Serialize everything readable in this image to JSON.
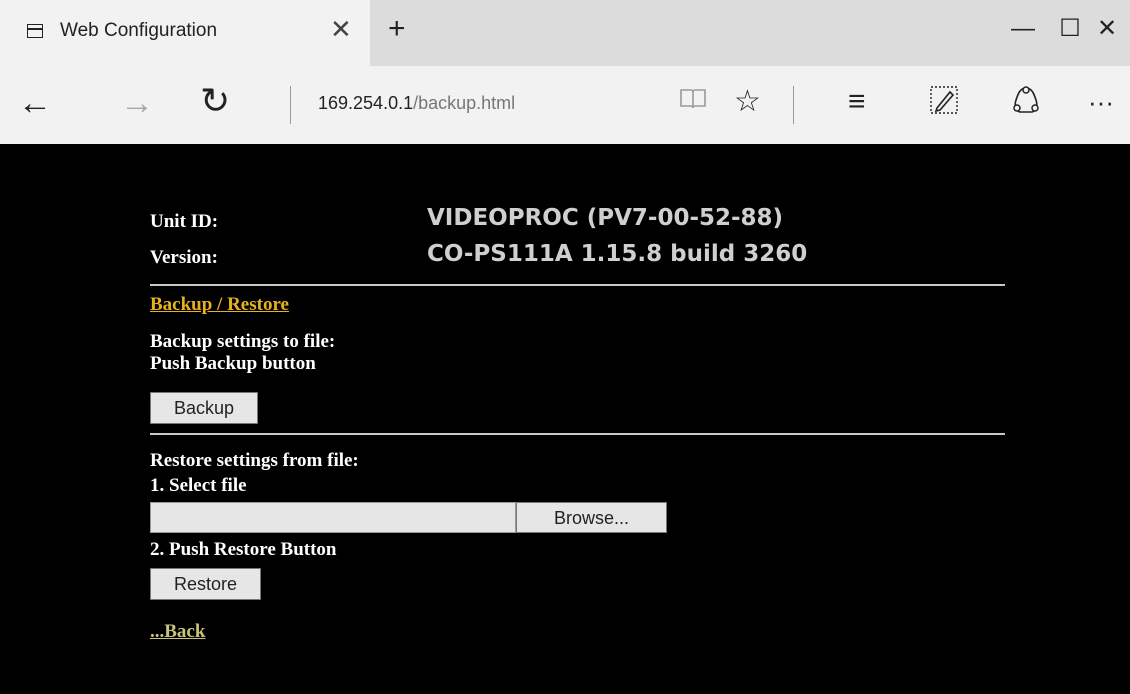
{
  "browser": {
    "tab_title": "Web Configuration",
    "tab_close": "✕",
    "new_tab": "+",
    "window": {
      "minimize": "—",
      "maximize": "☐",
      "close": "✕"
    },
    "nav": {
      "back": "←",
      "forward": "→",
      "refresh": "↻"
    },
    "url_host": "169.254.0.1",
    "url_path": "/backup.html",
    "tools": {
      "reading_view": "📖",
      "favorite": "☆",
      "hub": "≡",
      "web_note": "✎",
      "share": "⌂",
      "more": "···"
    }
  },
  "info": {
    "unit_id_label": "Unit ID:",
    "unit_id_value": "VIDEOPROC (PV7-00-52-88)",
    "version_label": "Version:",
    "version_value": "CO-PS111A 1.15.8 build 3260"
  },
  "backup": {
    "section_link": "Backup / Restore",
    "line1": "Backup settings to file:",
    "line2": "Push Backup button",
    "button": "Backup"
  },
  "restore": {
    "line1": "Restore settings from file:",
    "step1": "1. Select file",
    "browse_button": "Browse...",
    "step2": "2. Push Restore Button",
    "button": "Restore"
  },
  "back_link": "...Back",
  "colors": {
    "accent_link": "#e8b21c",
    "back_link": "#c8c47a",
    "background": "#000000"
  }
}
